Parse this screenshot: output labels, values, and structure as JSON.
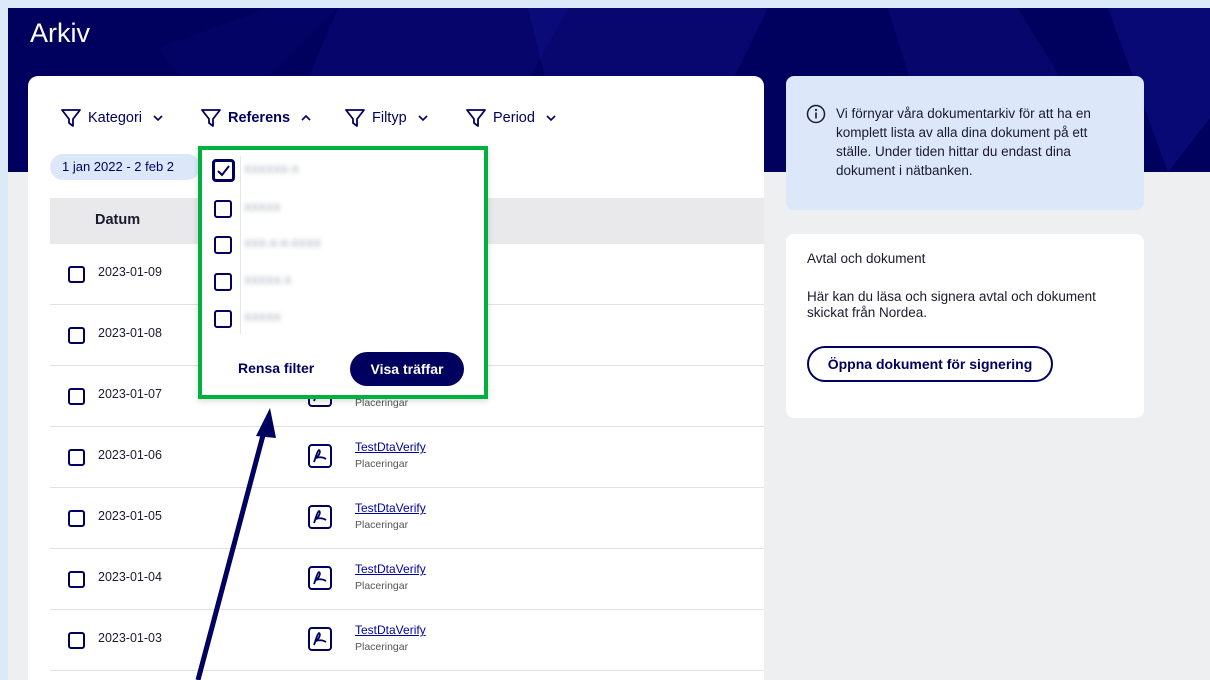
{
  "page": {
    "title": "Arkiv"
  },
  "filters": [
    {
      "label": "Kategori",
      "active": false,
      "chevron": "down"
    },
    {
      "label": "Referens",
      "active": true,
      "chevron": "up"
    },
    {
      "label": "Filtyp",
      "active": false,
      "chevron": "down"
    },
    {
      "label": "Period",
      "active": false,
      "chevron": "down"
    }
  ],
  "date_chip": "1 jan 2022 - 2 feb 2",
  "table": {
    "header_date": "Datum",
    "rows": [
      {
        "date": "2023-01-09",
        "doc": "",
        "category": ""
      },
      {
        "date": "2023-01-08",
        "doc": "",
        "category": ""
      },
      {
        "date": "2023-01-07",
        "doc": "",
        "category": "Placeringar"
      },
      {
        "date": "2023-01-06",
        "doc": "TestDtaVerify",
        "category": "Placeringar"
      },
      {
        "date": "2023-01-05",
        "doc": "TestDtaVerify",
        "category": "Placeringar"
      },
      {
        "date": "2023-01-04",
        "doc": "TestDtaVerify",
        "category": "Placeringar"
      },
      {
        "date": "2023-01-03",
        "doc": "TestDtaVerify",
        "category": "Placeringar"
      }
    ]
  },
  "dropdown": {
    "items": [
      {
        "label": "XXXXXX-X",
        "checked": true
      },
      {
        "label": "XXXXX",
        "checked": false
      },
      {
        "label": "XXX-X-X-XXXX",
        "checked": false
      },
      {
        "label": "XXXXX-X",
        "checked": false
      },
      {
        "label": "XXXXX",
        "checked": false
      }
    ],
    "clear_label": "Rensa filter",
    "apply_label": "Visa träffar"
  },
  "info_box": {
    "text": "Vi förnyar våra dokumentarkiv för att ha en komplett lista av alla dina dokument på ett ställe. Under tiden hittar du endast dina dokument i nätbanken."
  },
  "avtal_box": {
    "title": "Avtal och dokument",
    "text": "Här kan du läsa och signera avtal och dokument skickat från Nordea.",
    "button": "Öppna dokument för signering"
  },
  "colors": {
    "brand_navy": "#00005e",
    "highlight_green": "#00b140",
    "info_bg": "#dce8fa"
  }
}
